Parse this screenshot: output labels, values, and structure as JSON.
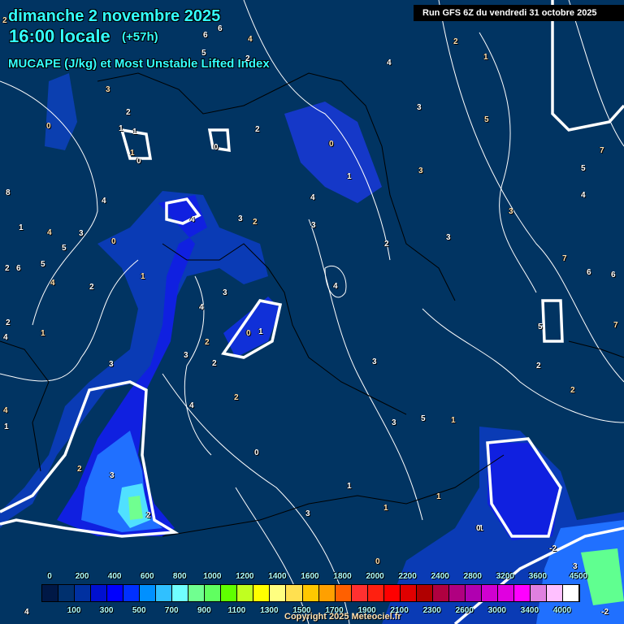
{
  "header": {
    "date": "dimanche 2 novembre 2025",
    "time": "16:00 locale",
    "lead": "(+57h)",
    "parameter": "MUCAPE (J/kg) et Most Unstable Lifted Index",
    "run": "Run GFS 6Z du vendredi 31 octobre 2025"
  },
  "colors": {
    "background": "#013462",
    "title": "#33ffff"
  },
  "legend": {
    "top_labels": [
      "0",
      "200",
      "400",
      "600",
      "800",
      "1000",
      "1200",
      "1400",
      "1600",
      "1800",
      "2000",
      "2200",
      "2400",
      "2800",
      "3200",
      "3600",
      "4500"
    ],
    "bottom_labels": [
      "100",
      "300",
      "500",
      "700",
      "900",
      "1100",
      "1300",
      "1500",
      "1700",
      "1900",
      "2100",
      "2300",
      "2600",
      "3000",
      "3400",
      "4000"
    ],
    "colors": [
      "#001846",
      "#00306e",
      "#0030a0",
      "#0010d0",
      "#0000ff",
      "#0030ff",
      "#0090ff",
      "#30c0ff",
      "#70ffff",
      "#70ff90",
      "#60ff60",
      "#60ff00",
      "#c0ff20",
      "#ffff00",
      "#ffff80",
      "#ffe050",
      "#ffc800",
      "#ffa000",
      "#ff6000",
      "#ff3030",
      "#ff2010",
      "#ff0000",
      "#e00000",
      "#b00000",
      "#b00040",
      "#b00080",
      "#b000b0",
      "#d000d0",
      "#e000e0",
      "#ff00ff",
      "#e080e0",
      "#ffc0ff",
      "#ffffff"
    ]
  },
  "lifted_index_labels": [
    "2",
    "6",
    "6",
    "4",
    "5",
    "2",
    "3",
    "2",
    "1",
    "0",
    "1",
    "0",
    "1",
    "0",
    "2",
    "0",
    "1",
    "4",
    "4",
    "3",
    "1",
    "0",
    "4",
    "3",
    "2",
    "5",
    "2",
    "1",
    "3",
    "4",
    "2",
    "2",
    "3",
    "0",
    "1",
    "4",
    "2",
    "3",
    "3",
    "1",
    "5",
    "1",
    "2",
    "3",
    "2",
    "1",
    "3",
    "0",
    "1",
    "-1",
    "-2",
    "0",
    "3",
    "2",
    "1",
    "1",
    "2",
    "1",
    "4",
    "3",
    "5",
    "2",
    "3",
    "7",
    "5",
    "4",
    "3",
    "6",
    "8",
    "7",
    "6",
    "5",
    "4",
    "-2",
    "0",
    "4",
    "4",
    "4",
    "7",
    "2",
    "5",
    "2",
    "6",
    "3",
    "3",
    "3",
    "4",
    "2",
    "4"
  ],
  "copyright": "Copyright 2025 Meteociel.fr"
}
